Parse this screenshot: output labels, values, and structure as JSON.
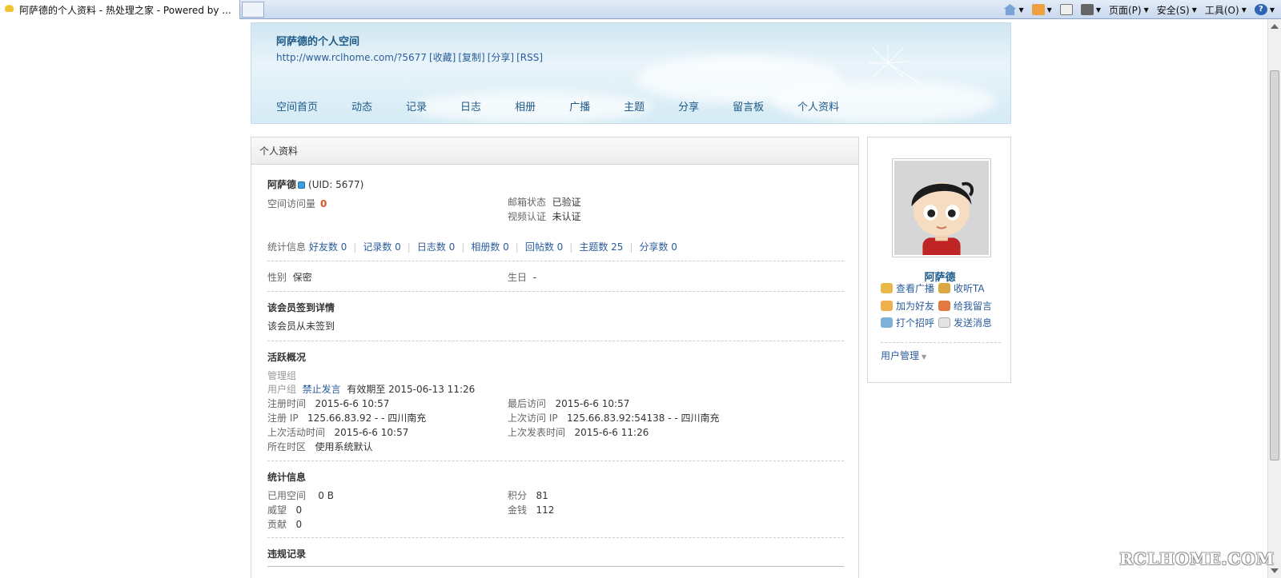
{
  "browser": {
    "tab_title": "阿萨德的个人资料 - 热处理之家 - Powered by ...",
    "commands": {
      "page": "页面(P)",
      "safety": "安全(S)",
      "tools": "工具(O)"
    }
  },
  "header": {
    "space_title": "阿萨德的个人空间",
    "space_url": "http://www.rclhome.com/?5677",
    "link_favorite": "[收藏]",
    "link_copy": "[复制]",
    "link_share": "[分享]",
    "link_rss": "[RSS]",
    "nav": [
      "空间首页",
      "动态",
      "记录",
      "日志",
      "相册",
      "广播",
      "主题",
      "分享",
      "留言板",
      "个人资料"
    ]
  },
  "main": {
    "panel_title": "个人资料",
    "username": "阿萨德",
    "uid": "(UID: 5677)",
    "visits_label": "空间访问量",
    "visits_value": "0",
    "email_status_label": "邮箱状态",
    "email_status_value": "已验证",
    "video_auth_label": "视频认证",
    "video_auth_value": "未认证",
    "stats_label": "统计信息",
    "stats_links": [
      "好友数 0",
      "记录数 0",
      "日志数 0",
      "相册数 0",
      "回帖数 0",
      "主题数 25",
      "分享数 0"
    ],
    "gender_label": "性别",
    "gender_value": "保密",
    "birthday_label": "生日",
    "birthday_value": "-",
    "checkin_title": "该会员签到详情",
    "checkin_text": "该会员从未签到",
    "activity_title": "活跃概况",
    "admin_group_label": "管理组",
    "user_group_label": "用户组",
    "user_group_value": "禁止发言",
    "user_group_expiry": "有效期至 2015-06-13 11:26",
    "reg_time_label": "注册时间",
    "reg_time_value": "2015-6-6 10:57",
    "last_visit_label": "最后访问",
    "last_visit_value": "2015-6-6 10:57",
    "reg_ip_label": "注册 IP",
    "reg_ip_value": "125.66.83.92 - - 四川南充",
    "last_ip_label": "上次访问 IP",
    "last_ip_value": "125.66.83.92:54138 - - 四川南充",
    "last_active_label": "上次活动时间",
    "last_active_value": "2015-6-6 10:57",
    "last_post_label": "上次发表时间",
    "last_post_value": "2015-6-6 11:26",
    "timezone_label": "所在时区",
    "timezone_value": "使用系统默认",
    "stats_title": "统计信息",
    "used_space_label": "已用空间",
    "used_space_value": "0 B",
    "points_label": "积分",
    "points_value": "81",
    "prestige_label": "威望",
    "prestige_value": "0",
    "money_label": "金钱",
    "money_value": "112",
    "contribution_label": "贡献",
    "contribution_value": "0",
    "violation_title": "违规记录"
  },
  "sidebar": {
    "name": "阿萨德",
    "actions": [
      "查看广播",
      "收听TA",
      "加为好友",
      "给我留言",
      "打个招呼",
      "发送消息"
    ],
    "user_mgmt": "用户管理"
  },
  "watermark": "RCLHOME.COM",
  "colors": {
    "link": "#2b5c9c",
    "header_text": "#1d5a8a",
    "count_red": "#e0542b"
  }
}
